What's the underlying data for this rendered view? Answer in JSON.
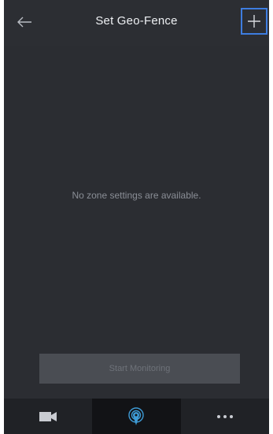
{
  "header": {
    "title": "Set Geo-Fence",
    "back_icon": "arrow-left-icon",
    "add_icon": "plus-icon"
  },
  "main": {
    "empty_message": "No zone settings are available.",
    "start_button_label": "Start Monitoring"
  },
  "tabbar": {
    "tabs": [
      {
        "icon": "video-camera-icon",
        "active": false
      },
      {
        "icon": "geofence-icon",
        "active": true
      },
      {
        "icon": "more-icon",
        "active": false
      }
    ]
  },
  "colors": {
    "accent": "#3e7de0",
    "background": "#2b2d32",
    "tabbar": "#202226"
  }
}
